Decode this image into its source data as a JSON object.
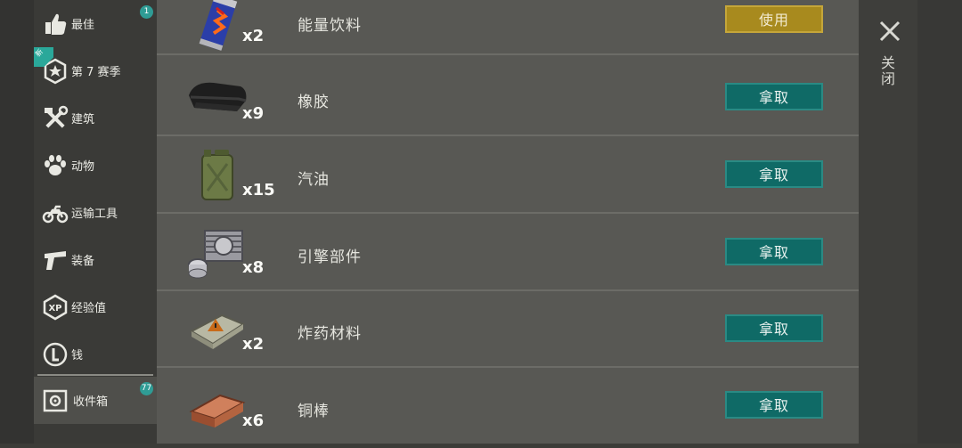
{
  "sidebar": {
    "items": [
      {
        "label": "最佳",
        "badge": "1",
        "icon": "thumbs-up-icon"
      },
      {
        "label": "第 7 赛季",
        "ribbon": "新",
        "icon": "season-star-icon"
      },
      {
        "label": "建筑",
        "icon": "hammer-wrench-icon"
      },
      {
        "label": "动物",
        "icon": "paw-icon"
      },
      {
        "label": "运输工具",
        "icon": "motorcycle-icon"
      },
      {
        "label": "装备",
        "icon": "pistol-icon"
      },
      {
        "label": "经验值",
        "icon": "xp-icon"
      },
      {
        "label": "钱",
        "icon": "coin-icon"
      },
      {
        "label": "收件箱",
        "badge": "77",
        "icon": "safe-icon",
        "active": true
      }
    ]
  },
  "items": [
    {
      "name": "能量饮料",
      "qty": "x2",
      "action": "使用",
      "icon": "energy-drink-icon"
    },
    {
      "name": "橡胶",
      "qty": "x9",
      "action": "拿取",
      "icon": "rubber-icon"
    },
    {
      "name": "汽油",
      "qty": "x15",
      "action": "拿取",
      "icon": "jerrycan-icon"
    },
    {
      "name": "引擎部件",
      "qty": "x8",
      "action": "拿取",
      "icon": "engine-part-icon"
    },
    {
      "name": "炸药材料",
      "qty": "x2",
      "action": "拿取",
      "icon": "explosive-icon"
    },
    {
      "name": "铜棒",
      "qty": "x6",
      "action": "拿取",
      "icon": "copper-bar-icon"
    }
  ],
  "close": {
    "label": "关闭"
  },
  "colors": {
    "take_button": "#0f6a66",
    "use_button": "#a88a1e",
    "badge": "#2f9c95"
  }
}
